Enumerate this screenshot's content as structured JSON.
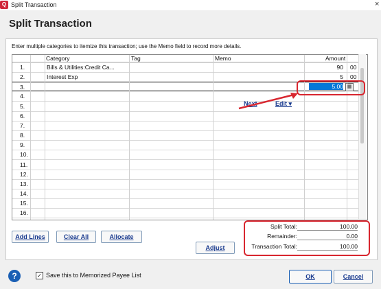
{
  "window": {
    "title": "Split Transaction",
    "heading": "Split Transaction",
    "close": "×",
    "app_icon": "Q"
  },
  "instructions": "Enter multiple categories to itemize this transaction; use the Memo field to record more details.",
  "columns": {
    "category": "Category",
    "tag": "Tag",
    "memo": "Memo",
    "amount": "Amount"
  },
  "rows": [
    {
      "num": "1.",
      "category": "Bills & Utilities:Credit Ca...",
      "tag": "",
      "memo": "",
      "amount": "90",
      "cents": "00"
    },
    {
      "num": "2.",
      "category": "Interest Exp",
      "tag": "",
      "memo": "",
      "amount": "5",
      "cents": "00"
    },
    {
      "num": "3.",
      "category": "",
      "tag": "",
      "memo": "",
      "amount": "5.00",
      "cents": ""
    },
    {
      "num": "4.",
      "category": "",
      "tag": "",
      "memo": "",
      "amount": "",
      "cents": ""
    },
    {
      "num": "5.",
      "category": "",
      "tag": "",
      "memo": "",
      "amount": "",
      "cents": ""
    },
    {
      "num": "6.",
      "category": "",
      "tag": "",
      "memo": "",
      "amount": "",
      "cents": ""
    },
    {
      "num": "7.",
      "category": "",
      "tag": "",
      "memo": "",
      "amount": "",
      "cents": ""
    },
    {
      "num": "8.",
      "category": "",
      "tag": "",
      "memo": "",
      "amount": "",
      "cents": ""
    },
    {
      "num": "9.",
      "category": "",
      "tag": "",
      "memo": "",
      "amount": "",
      "cents": ""
    },
    {
      "num": "10.",
      "category": "",
      "tag": "",
      "memo": "",
      "amount": "",
      "cents": ""
    },
    {
      "num": "11.",
      "category": "",
      "tag": "",
      "memo": "",
      "amount": "",
      "cents": ""
    },
    {
      "num": "12.",
      "category": "",
      "tag": "",
      "memo": "",
      "amount": "",
      "cents": ""
    },
    {
      "num": "13.",
      "category": "",
      "tag": "",
      "memo": "",
      "amount": "",
      "cents": ""
    },
    {
      "num": "14.",
      "category": "",
      "tag": "",
      "memo": "",
      "amount": "",
      "cents": ""
    },
    {
      "num": "15.",
      "category": "",
      "tag": "",
      "memo": "",
      "amount": "",
      "cents": ""
    },
    {
      "num": "16.",
      "category": "",
      "tag": "",
      "memo": "",
      "amount": "",
      "cents": ""
    }
  ],
  "row_actions": {
    "next": "Next",
    "edit": "Edit ▾"
  },
  "buttons": {
    "add_lines": "Add Lines",
    "clear_all": "Clear All",
    "allocate": "Allocate",
    "adjust": "Adjust",
    "ok": "OK",
    "cancel": "Cancel"
  },
  "totals": {
    "split_total_label": "Split Total:",
    "split_total": "100.00",
    "remainder_label": "Remainder:",
    "remainder": "0.00",
    "transaction_total_label": "Transaction Total:",
    "transaction_total": "100.00"
  },
  "footer": {
    "memorize_label": "Save this to Memorized Payee List",
    "memorize_checked": true,
    "help": "?"
  },
  "colors": {
    "accent": "#1a3b8f",
    "highlight": "#d8262f",
    "selection": "#0078d7"
  }
}
